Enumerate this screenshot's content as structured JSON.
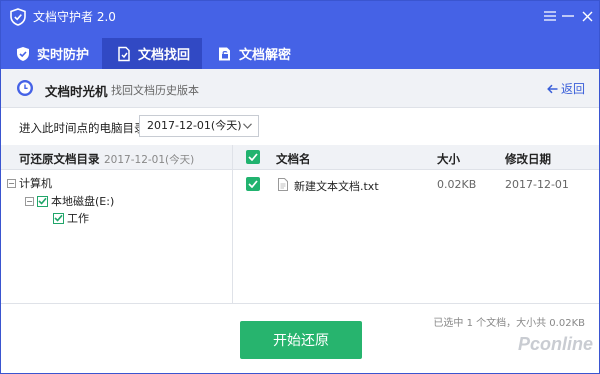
{
  "app": {
    "title": "文档守护者 2.0"
  },
  "tabs": [
    {
      "label": "实时防护",
      "active": false
    },
    {
      "label": "文档找回",
      "active": true
    },
    {
      "label": "文档解密",
      "active": false
    }
  ],
  "header": {
    "title": "文档时光机",
    "subtitle": "找回文档历史版本",
    "back_label": "返回"
  },
  "date_picker": {
    "label": "进入此时间点的电脑目录",
    "value": "2017-12-01(今天)"
  },
  "tree": {
    "heading": "可还原文档目录",
    "date": "2017-12-01(今天)",
    "nodes": [
      {
        "label": "计算机",
        "checked": false
      },
      {
        "label": "本地磁盘(E:)",
        "checked": true
      },
      {
        "label": "工作",
        "checked": true
      }
    ]
  },
  "files": {
    "columns": {
      "name": "文档名",
      "size": "大小",
      "date": "修改日期"
    },
    "rows": [
      {
        "name": "新建文本文档.txt",
        "size": "0.02KB",
        "date": "2017-12-01",
        "checked": true
      }
    ]
  },
  "footer": {
    "summary": "已选中 1 个文档，大小共 0.02KB",
    "start_label": "开始还原",
    "watermark": "Pconline"
  },
  "colors": {
    "brand": "#4562e6",
    "accent_green": "#27b46e",
    "link": "#3a5fd9"
  }
}
